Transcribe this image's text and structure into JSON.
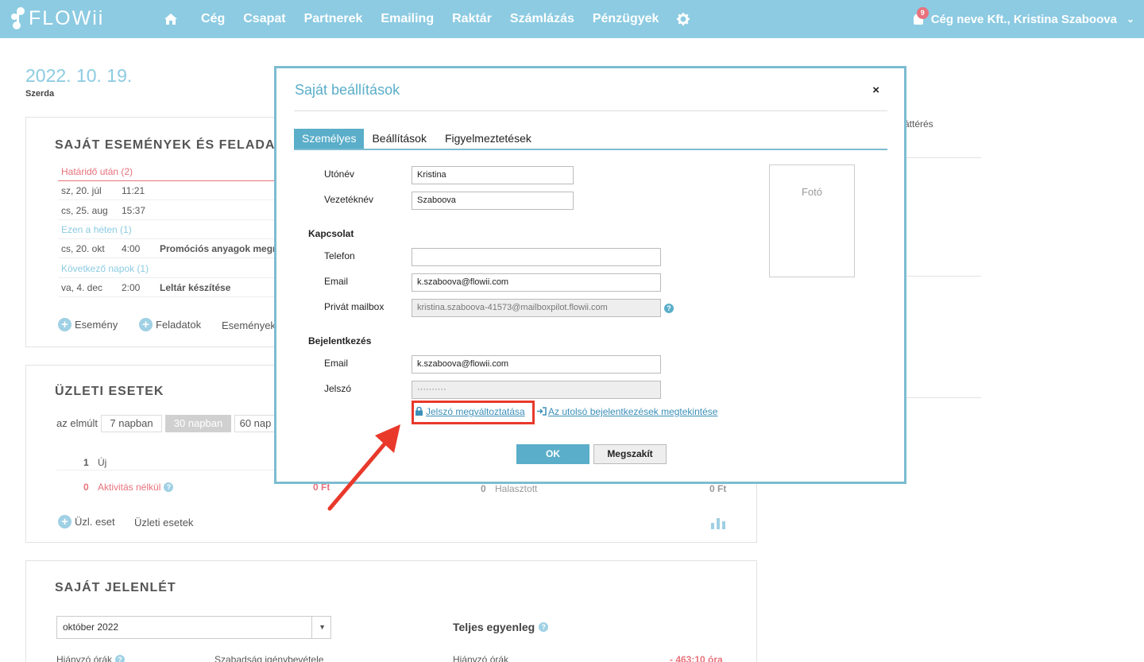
{
  "app": {
    "logo": "FLOWii"
  },
  "nav": {
    "items": [
      "Cég",
      "Csapat",
      "Partnerek",
      "Emailing",
      "Raktár",
      "Számlázás",
      "Pénzügyek"
    ],
    "notifications": "9",
    "user": "Cég neve Kft., Kristina Szaboova"
  },
  "page": {
    "date": "2022. 10. 19.",
    "weekday": "Szerda",
    "right_fragment": "áttérés"
  },
  "events": {
    "title": "SAJÁT ESEMÉNYEK ÉS FELADATO",
    "groups": {
      "overdue": "Határidő után (2)",
      "this_week": "Ezen a héten (1)",
      "next_days": "Következő napok (1)"
    },
    "rows": [
      {
        "date": "sz, 20. júl",
        "time": "11:21",
        "text": ""
      },
      {
        "date": "cs, 25. aug",
        "time": "15:37",
        "text": ""
      },
      {
        "date": "cs, 20. okt",
        "time": "4:00",
        "text": "Promóciós anyagok megre"
      },
      {
        "date": "va, 4. dec",
        "time": "2:00",
        "text": "Leltár készítése"
      }
    ],
    "add_event": "Esemény",
    "add_task": "Feladatok",
    "events_link": "Események"
  },
  "deals": {
    "title": "ÜZLETI ESETEK",
    "since_label": "az elmúlt",
    "periods": [
      "7 napban",
      "30 napban",
      "60 nap"
    ],
    "new_count": "1",
    "new_label": "Új",
    "no_activity_count": "0",
    "no_activity_label": "Aktivitás nélkül",
    "no_activity_amount": "0 Ft",
    "postponed_count": "0",
    "postponed_label": "Halasztott",
    "postponed_amount": "0 Ft",
    "add_deal": "Üzl. eset",
    "deals_link": "Üzleti esetek"
  },
  "attendance": {
    "title": "SAJÁT JELENLÉT",
    "month": "október 2022",
    "balance_title": "Teljes egyenleg",
    "missing_hours": "Hiányzó órák",
    "leave_request": "Szabadság igénybevétele",
    "missing_hours_right": "Hiányzó órák",
    "missing_value": "- 463:10 óra"
  },
  "modal": {
    "title": "Saját beállítások",
    "close": "×",
    "tabs": [
      "Személyes",
      "Beállítások",
      "Figyelmeztetések"
    ],
    "first_name_label": "Utónév",
    "first_name": "Kristina",
    "last_name_label": "Vezetéknév",
    "last_name": "Szaboova",
    "contact_section": "Kapcsolat",
    "phone_label": "Telefon",
    "phone": "",
    "email_label": "Email",
    "email": "k.szaboova@flowii.com",
    "mailbox_label": "Privát mailbox",
    "mailbox": "kristina.szaboova-41573@mailboxpilot.flowii.com",
    "login_section": "Bejelentkezés",
    "login_email_label": "Email",
    "login_email": "k.szaboova@flowii.com",
    "password_label": "Jelszó",
    "password": "··········",
    "photo": "Fotó",
    "change_password": "Jelszó megváltoztatása",
    "last_logins": "Az utolsó bejelentkezések megtekintése",
    "ok": "OK",
    "cancel": "Megszakít"
  },
  "colors": {
    "nav_bg": "#8ccbe2",
    "accent": "#5aaec9",
    "highlight": "#e8392b",
    "overdue": "#e8727c"
  }
}
